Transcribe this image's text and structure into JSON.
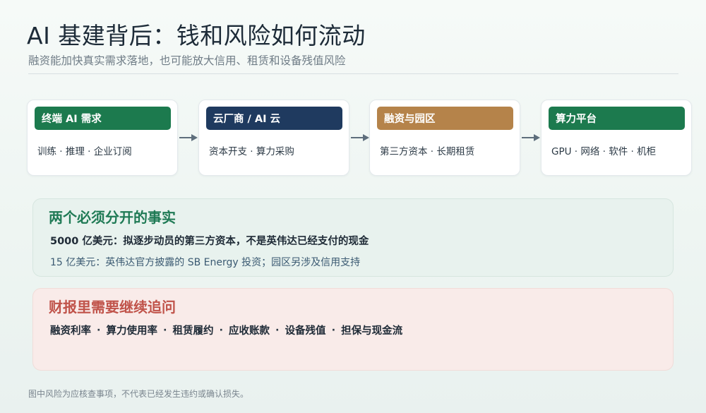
{
  "header": {
    "title": "AI 基建背后：钱和风险如何流动",
    "subtitle": "融资能加快真实需求落地，也可能放大信用、租赁和设备残值风险"
  },
  "flow": [
    {
      "label": "终端 AI 需求",
      "desc": "训练 · 推理 · 企业订阅",
      "color": "#1c7a4e"
    },
    {
      "label": "云厂商 / AI 云",
      "desc": "资本开支 · 算力采购",
      "color": "#1f3a5f"
    },
    {
      "label": "融资与园区",
      "desc": "第三方资本 · 长期租赁",
      "color": "#b5834a"
    },
    {
      "label": "算力平台",
      "desc": "GPU · 网络 · 软件 · 机柜",
      "color": "#1c7a4e"
    }
  ],
  "facts": {
    "title": "两个必须分开的事实",
    "line1": "5000 亿美元：拟逐步动员的第三方资本，不是英伟达已经支付的现金",
    "line2": "15 亿美元：英伟达官方披露的 SB Energy 投资；园区另涉及信用支持"
  },
  "risks": {
    "title": "财报里需要继续追问",
    "items": [
      "融资利率",
      "算力使用率",
      "租赁履约",
      "应收账款",
      "设备残值",
      "担保与现金流"
    ],
    "separator": "·"
  },
  "footnote": "图中风险为应核查事项，不代表已经发生违约或确认损失。"
}
